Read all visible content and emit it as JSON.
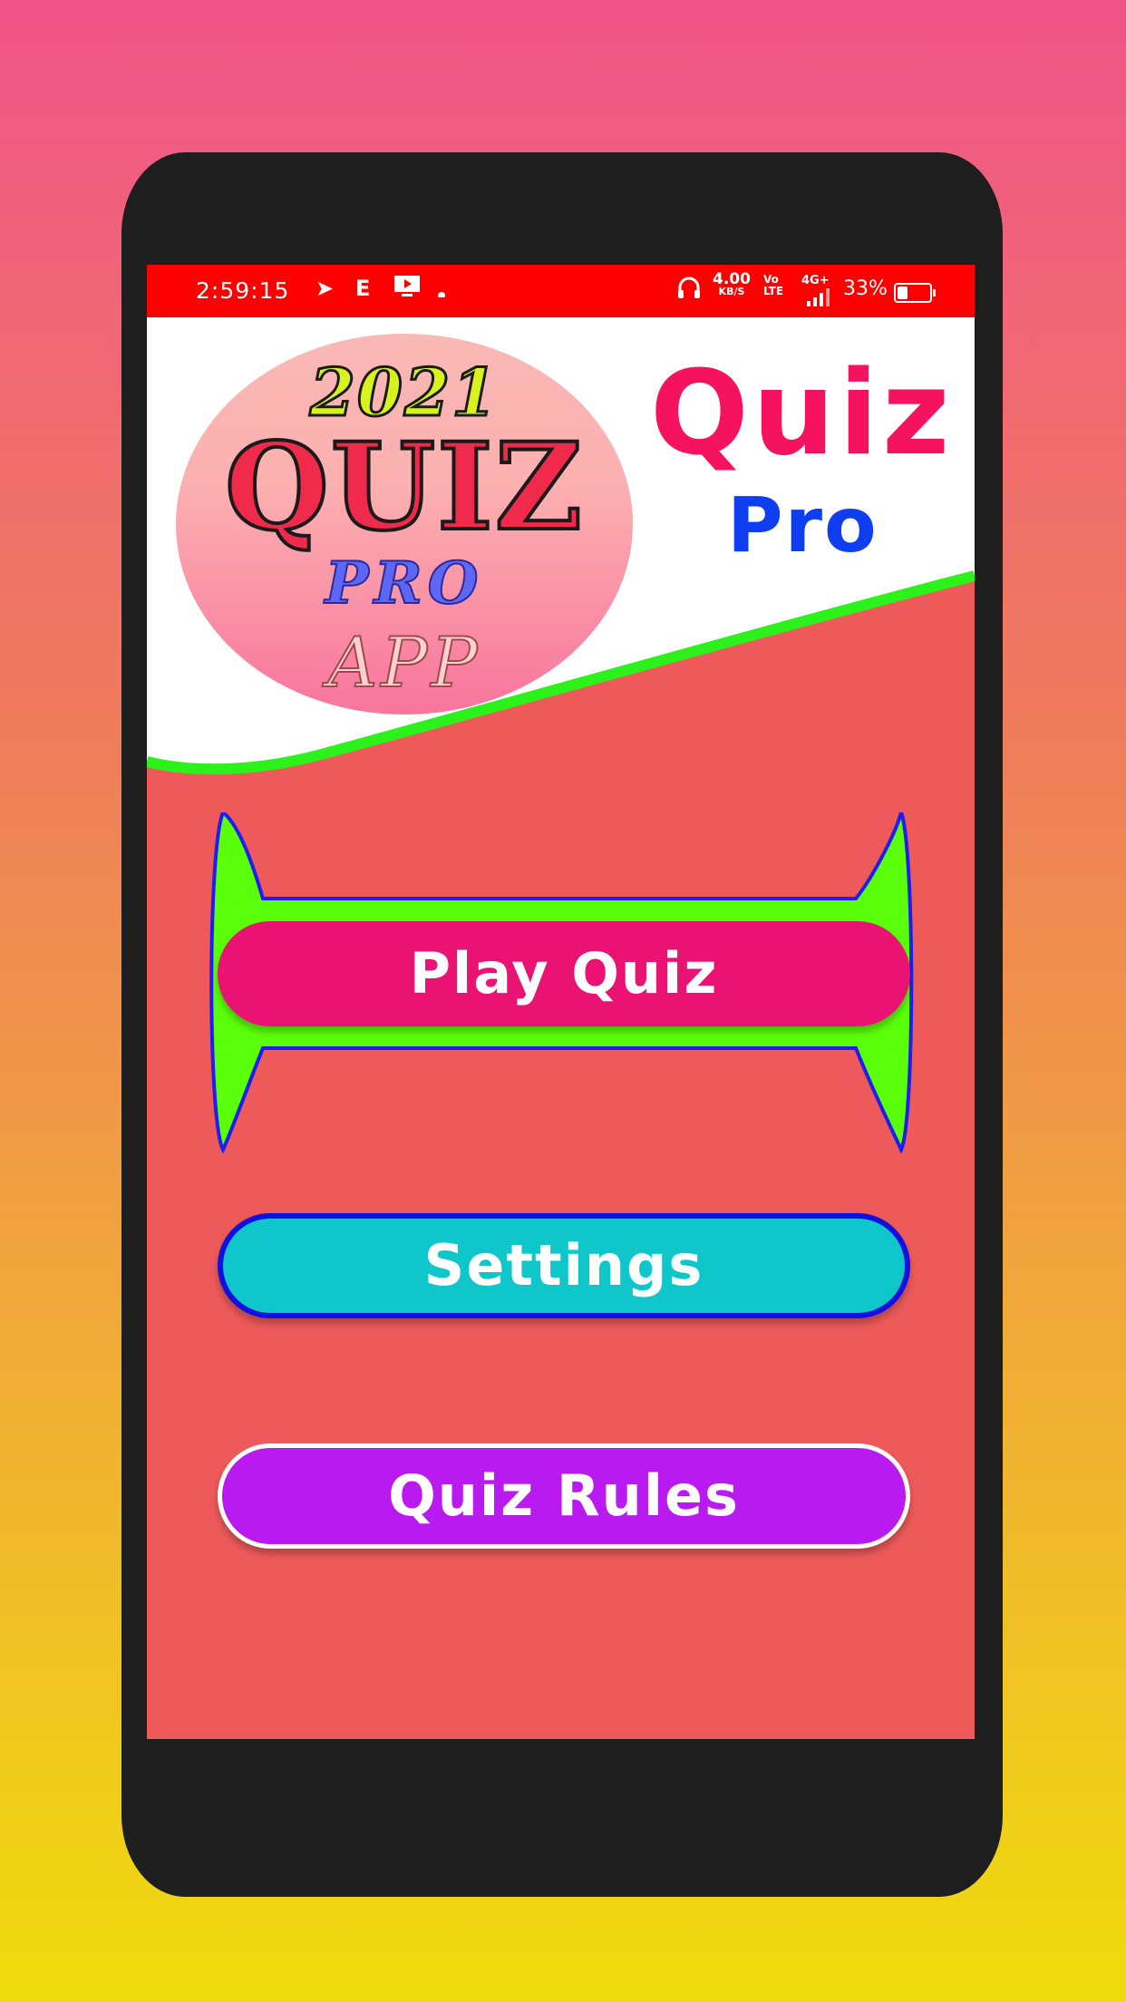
{
  "status_bar": {
    "time": "2:59:15",
    "speed_value": "4.00",
    "speed_unit": "KB/S",
    "volte_top": "Vo",
    "volte_bottom": "LTE",
    "network": "4G+",
    "battery_percent": "33%",
    "battery_level": 0.33,
    "icons": [
      "telegram-icon",
      "e-icon",
      "screen-cast-icon",
      "dot-icon",
      "headphones-icon",
      "signal-icon",
      "battery-icon"
    ]
  },
  "logo": {
    "year": "2021",
    "word1": "QUIZ",
    "word2": "PRO",
    "word3": "APP"
  },
  "header": {
    "title": "Quiz",
    "subtitle": "Pro"
  },
  "menu": {
    "play_label": "Play Quiz",
    "settings_label": "Settings",
    "rules_label": "Quiz Rules"
  },
  "colors": {
    "status_bar": "#fd0000",
    "screen_bg": "#ee5a5a",
    "accent_green": "#5aff0a",
    "play_button": "#ea1272",
    "settings_button": "#0fc7cb",
    "rules_button": "#b81af0",
    "title_quiz": "#f5125f",
    "title_pro": "#0f3df0"
  }
}
